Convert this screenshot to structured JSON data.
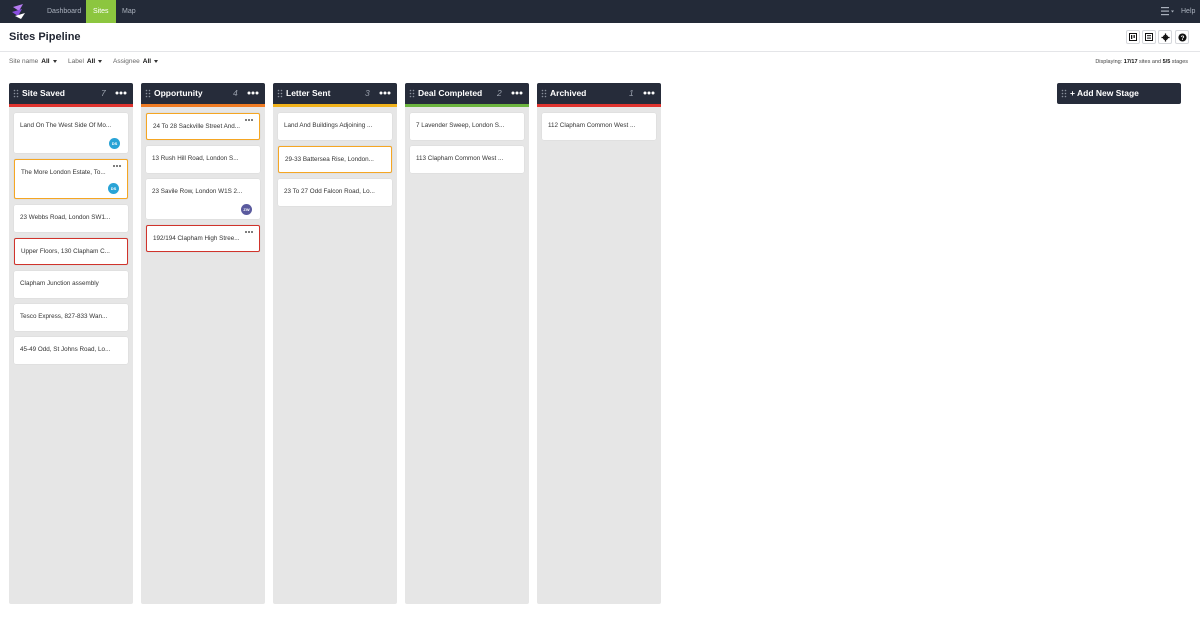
{
  "nav": {
    "items": [
      "Dashboard",
      "Sites",
      "Map"
    ],
    "help": "Help"
  },
  "page": {
    "title": "Sites Pipeline"
  },
  "filters": [
    {
      "label": "Site name",
      "value": "All"
    },
    {
      "label": "Label",
      "value": "All"
    },
    {
      "label": "Assignee",
      "value": "All"
    }
  ],
  "summary": {
    "prefix": "Displaying: ",
    "sites": "17/17",
    "mid": " sites and ",
    "stages": "5/5",
    "suffix": " stages"
  },
  "columns": [
    {
      "title": "Site Saved",
      "count": "7",
      "color": "#e0342f",
      "cards": [
        {
          "text": "Land On The West Side Of Mo...",
          "avatar": "DS",
          "avatar_color": "#29a3d6"
        },
        {
          "text": "The More London Estate, To...",
          "avatar": "DS",
          "avatar_color": "#29a3d6",
          "border": "orange",
          "menu": true
        },
        {
          "text": "23 Webbs Road, London SW1..."
        },
        {
          "text": "Upper Floors, 130 Clapham C...",
          "border": "red"
        },
        {
          "text": "Clapham Junction assembly"
        },
        {
          "text": "Tesco Express, 827-833 Wan..."
        },
        {
          "text": "45-49 Odd, St Johns Road, Lo..."
        }
      ]
    },
    {
      "title": "Opportunity",
      "count": "4",
      "color": "#f07c24",
      "cards": [
        {
          "text": "24 To 28 Sackville Street And...",
          "border": "orange",
          "menu": true
        },
        {
          "text": "13 Rush Hill Road, London S..."
        },
        {
          "text": "23 Savile Row, London W1S 2...",
          "avatar": "ZW",
          "avatar_color": "#5a5a9e"
        },
        {
          "text": "192/194 Clapham High Stree...",
          "border": "red",
          "menu": true
        }
      ]
    },
    {
      "title": "Letter Sent",
      "count": "3",
      "color": "#f2b31b",
      "cards": [
        {
          "text": "Land And Buildings Adjoining ..."
        },
        {
          "text": "29-33 Battersea Rise, London...",
          "border": "orange"
        },
        {
          "text": "23 To 27 Odd Falcon Road, Lo..."
        }
      ]
    },
    {
      "title": "Deal Completed",
      "count": "2",
      "color": "#6cb43f",
      "cards": [
        {
          "text": "7 Lavender Sweep, London S..."
        },
        {
          "text": "113 Clapham Common West ..."
        }
      ]
    },
    {
      "title": "Archived",
      "count": "1",
      "color": "#e0342f",
      "cards": [
        {
          "text": "112 Clapham Common West ..."
        }
      ]
    }
  ],
  "add_stage": {
    "label": "+ Add New Stage"
  },
  "icons": {
    "logo": "app-logo-icon",
    "menu": "hamburger-menu-icon",
    "board_view": "board-view-icon",
    "list_view": "list-view-icon",
    "settings": "gear-icon",
    "help": "help-icon"
  }
}
